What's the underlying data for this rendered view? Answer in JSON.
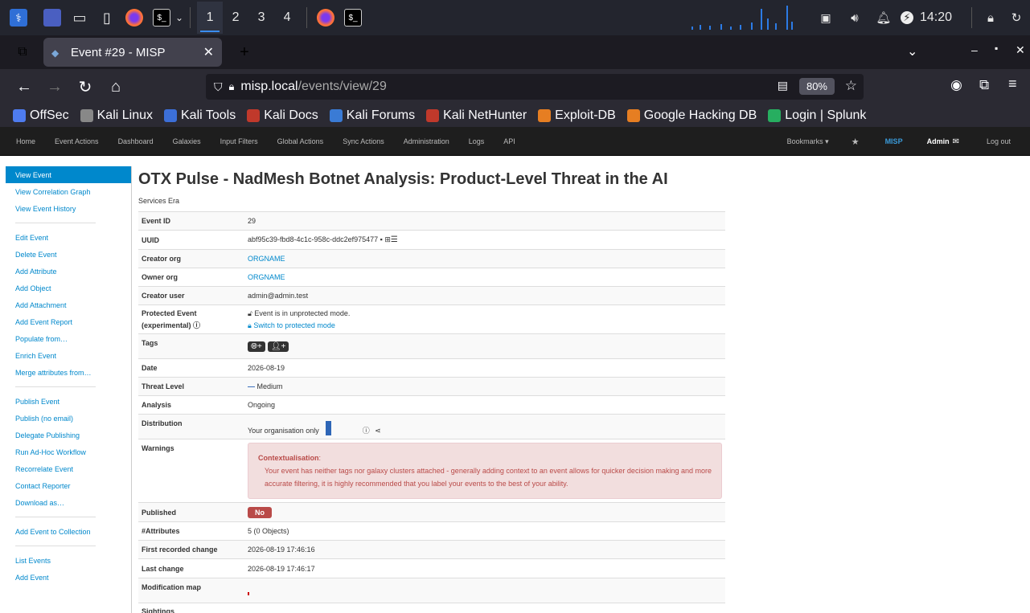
{
  "taskbar": {
    "workspaces": [
      "1",
      "2",
      "3",
      "4"
    ],
    "active_workspace": "1",
    "clock": "14:20"
  },
  "browser": {
    "tab_title": "Event #29 - MISP",
    "url_host": "misp.local",
    "url_path": "/events/view/29",
    "zoom": "80%",
    "bookmarks": [
      {
        "label": "OffSec",
        "color": "#4e7cf0"
      },
      {
        "label": "Kali Linux",
        "color": "#888888"
      },
      {
        "label": "Kali Tools",
        "color": "#3c6fd8"
      },
      {
        "label": "Kali Docs",
        "color": "#c0392b"
      },
      {
        "label": "Kali Forums",
        "color": "#3a7bd5"
      },
      {
        "label": "Kali NetHunter",
        "color": "#c0392b"
      },
      {
        "label": "Exploit-DB",
        "color": "#e67e22"
      },
      {
        "label": "Google Hacking DB",
        "color": "#e67e22"
      },
      {
        "label": "Login | Splunk",
        "color": "#27ae60"
      }
    ]
  },
  "misp": {
    "topnav": [
      "Home",
      "Event Actions",
      "Dashboard",
      "Galaxies",
      "Input Filters",
      "Global Actions",
      "Sync Actions",
      "Administration",
      "Logs",
      "API"
    ],
    "topnav_right": {
      "bookmarks": "Bookmarks ▾",
      "brand": "MISP",
      "user": "Admin",
      "logout": "Log out"
    },
    "sidebar": {
      "group1": [
        "View Event",
        "View Correlation Graph",
        "View Event History"
      ],
      "group2": [
        "Edit Event",
        "Delete Event",
        "Add Attribute",
        "Add Object",
        "Add Attachment",
        "Add Event Report",
        "Populate from…",
        "Enrich Event",
        "Merge attributes from…"
      ],
      "group3": [
        "Publish Event",
        "Publish (no email)",
        "Delegate Publishing",
        "Run Ad-Hoc Workflow",
        "Recorrelate Event",
        "Contact Reporter",
        "Download as…"
      ],
      "group4": [
        "Add Event to Collection"
      ],
      "group5": [
        "List Events",
        "Add Event"
      ]
    },
    "event": {
      "title": "OTX Pulse - NadMesh Botnet Analysis: Product-Level Threat in the AI",
      "subtitle": "Services Era",
      "labels": {
        "event_id": "Event ID",
        "uuid": "UUID",
        "creator_org": "Creator org",
        "owner_org": "Owner org",
        "creator_user": "Creator user",
        "protected_1": "Protected Event",
        "protected_2": "(experimental)",
        "tags": "Tags",
        "date": "Date",
        "threat_level": "Threat Level",
        "analysis": "Analysis",
        "distribution": "Distribution",
        "warnings": "Warnings",
        "published": "Published",
        "attributes": "#Attributes",
        "first_change": "First recorded change",
        "last_change": "Last change",
        "mod_map": "Modification map",
        "sightings": "Sightings"
      },
      "event_id": "29",
      "uuid": "abf95c39-fbd8-4c1c-958c-ddc2ef975477",
      "creator_org": "ORGNAME",
      "owner_org": "ORGNAME",
      "creator_user": "admin@admin.test",
      "protected_status": "Event is in unprotected mode.",
      "protected_link": "Switch to protected mode",
      "date": "2026-08-19",
      "threat_level": "Medium",
      "analysis": "Ongoing",
      "distribution": "Your organisation only",
      "warning_title": "Contextualisation",
      "warning_text": "Your event has neither tags nor galaxy clusters attached - generally adding context to an event allows for quicker decision making and more accurate filtering, it is highly recommended that you label your events to the best of your ability.",
      "published": "No",
      "attributes": "5 (0 Objects)",
      "first_change": "2026-08-19 17:46:16",
      "last_change": "2026-08-19 17:46:17"
    }
  }
}
